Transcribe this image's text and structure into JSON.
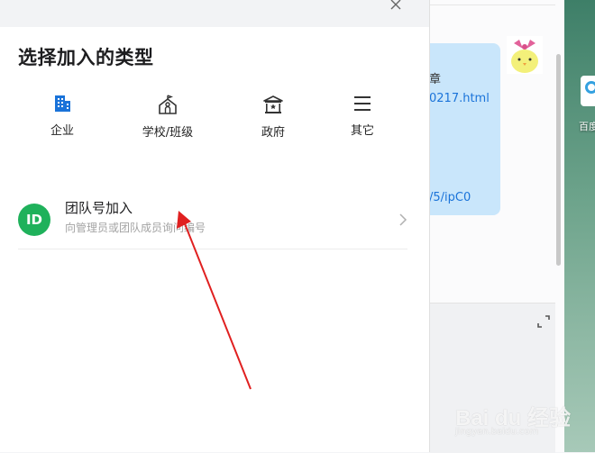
{
  "dialog": {
    "title": "选择加入的类型",
    "types": [
      {
        "label": "企业",
        "icon": "building-icon"
      },
      {
        "label": "学校/班级",
        "icon": "school-icon"
      },
      {
        "label": "政府",
        "icon": "government-icon"
      },
      {
        "label": "其它",
        "icon": "menu-icon"
      }
    ],
    "join_option": {
      "badge": "ID",
      "title": "团队号加入",
      "subtitle": "向管理员或团队成员询问编号"
    }
  },
  "background_chat": {
    "lines": [
      "章",
      "0217.html",
      "/5/ipC0"
    ]
  },
  "desktop": {
    "icon_label": "百度"
  },
  "watermark": {
    "text": "Bai du 经验",
    "sub": "jingyan.baidu.com"
  },
  "colors": {
    "accent_blue": "#1a73d9",
    "id_badge_green": "#1fb15b",
    "arrow_red": "#e02020"
  }
}
